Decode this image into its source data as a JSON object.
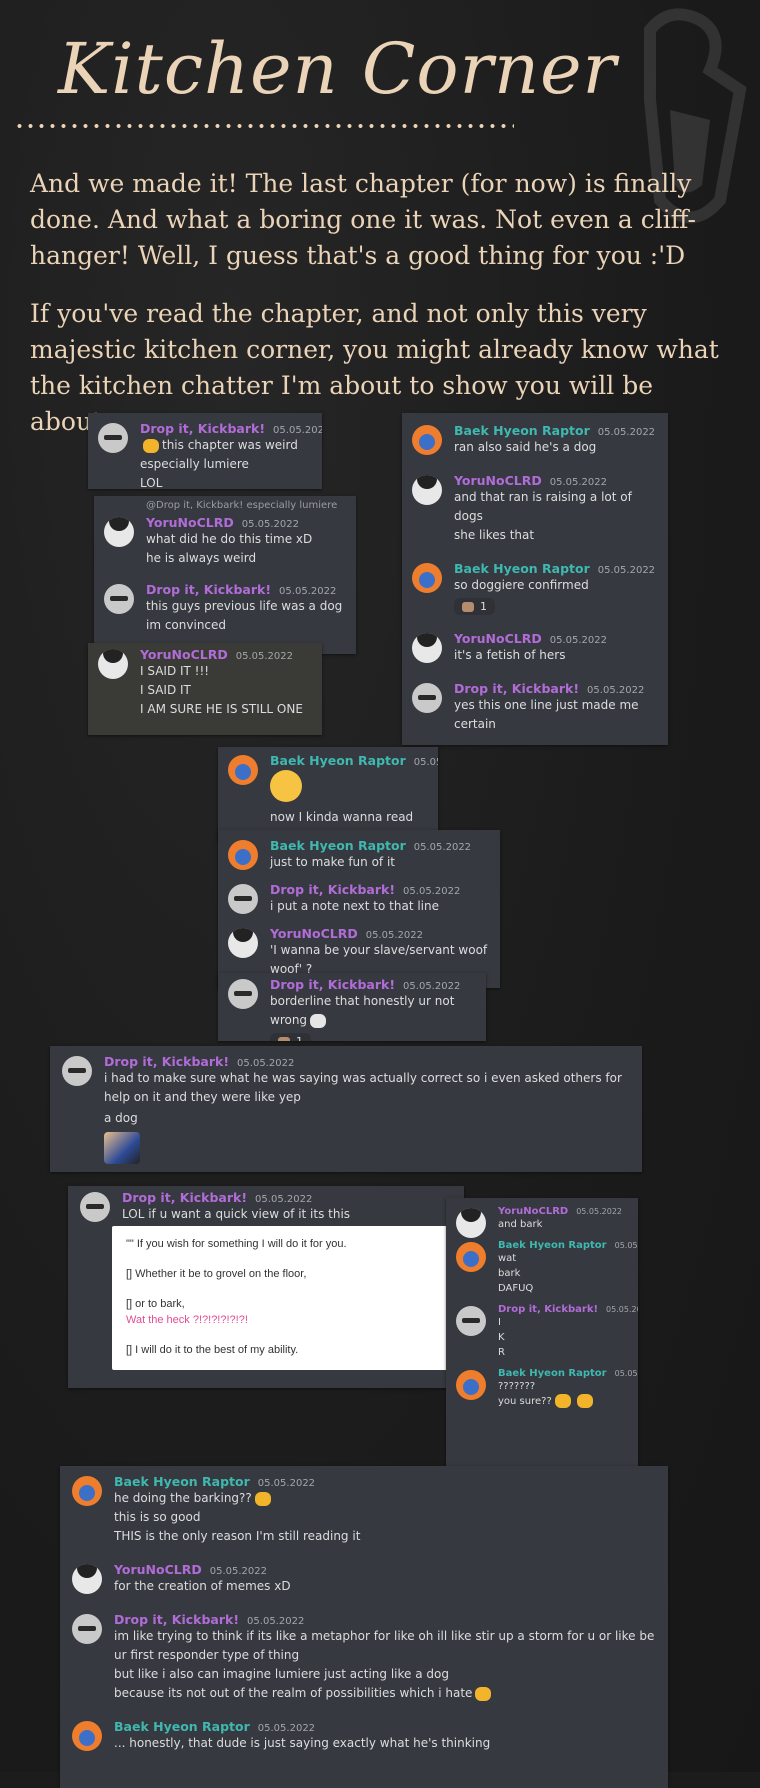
{
  "title": "Kitchen Corner",
  "intro_p1": "And we made it! The last chapter (for now) is finally done. And what a boring one it was. Not even a cliff-hanger! Well, I guess that's a good thing for you :'D",
  "intro_p2": "If you've read the chapter, and not only this very majestic kitchen corner, you might already know what the kitchen chatter I'm about to show you will be about~",
  "users": {
    "drop": "Drop it, Kickbark!",
    "yoru": "YoruNoCLRD",
    "raptor": "Baek Hyeon Raptor"
  },
  "date": "05.05.2022",
  "colors": {
    "background": "#1c1c1c",
    "title": "#ead3b6",
    "panel": "#36393f",
    "purple_name": "#b26cd8",
    "teal_name": "#3fb8b0"
  },
  "s1": {
    "m1": [
      "this chapter was weird",
      "especially lumiere",
      "LOL"
    ],
    "reply": "@Drop it, Kickbark! especially lumiere",
    "m2": [
      "what did he do this time xD",
      "he is always weird"
    ],
    "m3": [
      "this guys previous life was a dog",
      "im convinced"
    ],
    "m4": [
      "I SAID IT !!!",
      "I SAID IT",
      "I AM SURE HE IS STILL ONE"
    ]
  },
  "s2": {
    "m1": "ran also said he's a dog",
    "m2": [
      "and that ran is raising a lot of dogs",
      "she likes that"
    ],
    "m3": "so doggiere confirmed",
    "react": "1",
    "m4": "it's a fetish of hers",
    "m5": "yes this one line just made me certain"
  },
  "s3": {
    "m1": "now I kinda wanna read the tl",
    "m2": "just to make fun of it",
    "m3": "i put a note next to that line",
    "m4": "'I wanna be your slave/servant woof woof' ?",
    "m5": "borderline that honestly ur not wrong",
    "react": "1"
  },
  "s4": {
    "m1": "i had to make sure what he was saying was actually correct so i even asked others for help on it and they were like yep",
    "m2": "a dog"
  },
  "s5": {
    "m1": "LOL if u want a quick view of it its this",
    "quote": [
      "\"\" If you wish for something I will do it for you.",
      "[] Whether it be to grovel on the floor,",
      "[] or to bark,",
      "Wat  the  heck ?!?!?!?!?!?!",
      "[] I will do it to the best of my ability."
    ]
  },
  "s6": {
    "m1": "and bark",
    "m2": [
      "wat",
      "bark",
      "DAFUQ"
    ],
    "m3": [
      "I",
      "K",
      "R"
    ],
    "m4": [
      "???????",
      "you sure??"
    ]
  },
  "s7": {
    "m1": [
      "he doing the barking??",
      "this is so good",
      "THIS is the only reason I'm still reading it"
    ],
    "m2": "for the creation of memes xD",
    "m3": [
      "im like trying to think if its like a metaphor for like oh ill like stir up a storm for u or like be ur first responder type of thing",
      "but like i also can imagine lumiere just acting like a dog",
      "because its not out of the realm of possibilities which i hate"
    ],
    "m4": "... honestly, that dude is just saying exactly what he's thinking"
  }
}
